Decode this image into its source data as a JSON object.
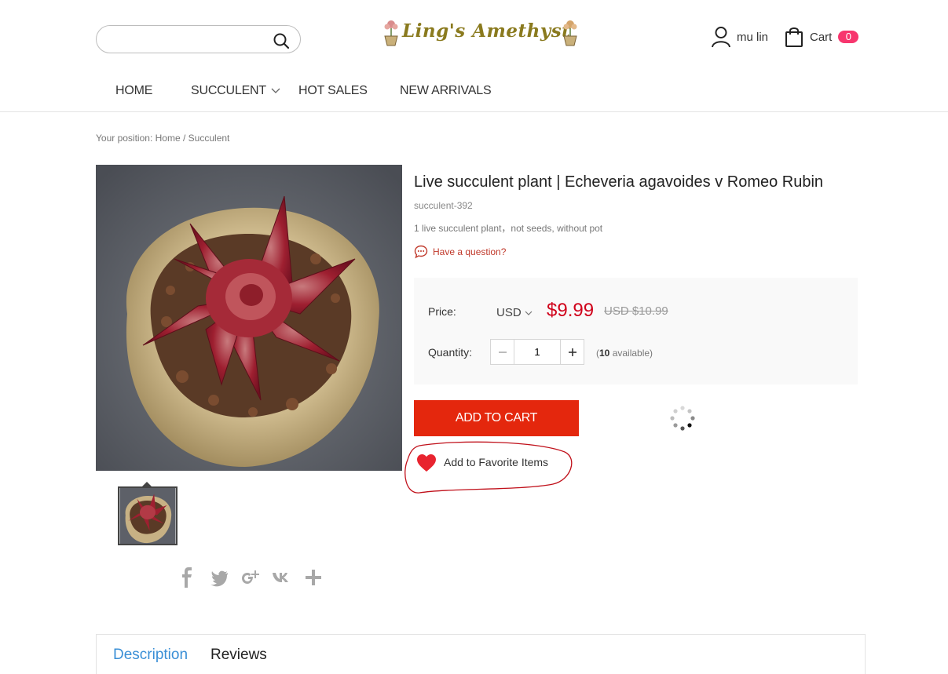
{
  "header": {
    "search_placeholder": "",
    "logo_text": "Ling's Amethyst",
    "user_name": "mu lin",
    "cart_label": "Cart",
    "cart_count": "0"
  },
  "nav": {
    "items": [
      {
        "label": "HOME"
      },
      {
        "label": "SUCCULENT"
      },
      {
        "label": "HOT SALES"
      },
      {
        "label": "NEW ARRIVALS"
      }
    ]
  },
  "breadcrumb": {
    "prefix": "Your position:",
    "home": "Home",
    "separator": "/",
    "current": "Succulent"
  },
  "product": {
    "title": "Live succulent plant | Echeveria agavoides v Romeo Rubin",
    "sku": "succulent-392",
    "short_desc": "1 live succulent plant，not seeds, without pot",
    "question_label": "Have a question?",
    "price_label": "Price:",
    "currency": "USD",
    "price": "$9.99",
    "old_price": "USD $10.99",
    "quantity_label": "Quantity:",
    "quantity_value": "1",
    "available_open": "(",
    "available_count": "10",
    "available_text": " available)",
    "add_to_cart_label": "ADD TO CART",
    "favorite_label": "Add to Favorite Items"
  },
  "share": {
    "icons": [
      "facebook-icon",
      "twitter-icon",
      "google-plus-icon",
      "vk-icon",
      "plus-icon"
    ]
  },
  "tabs": [
    {
      "label": "Description",
      "active": true
    },
    {
      "label": "Reviews",
      "active": false
    }
  ],
  "colors": {
    "accent_red": "#e4270d",
    "price_red": "#d0021b",
    "cart_badge": "#f7366e",
    "active_tab": "#3a8fd6",
    "logo_text": "#8a7a1e"
  }
}
